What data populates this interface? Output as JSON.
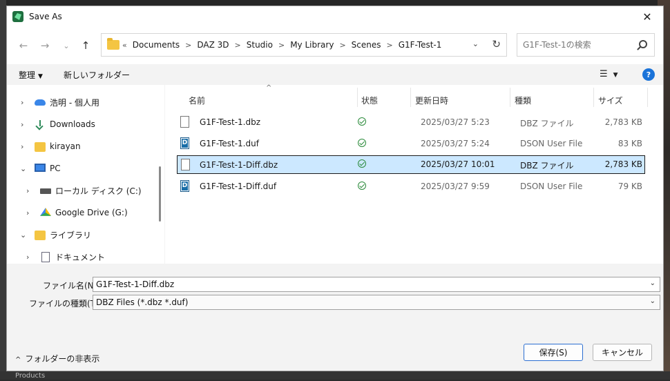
{
  "window": {
    "title": "Save As"
  },
  "address": {
    "lead": "«",
    "crumbs": [
      "Documents",
      "DAZ 3D",
      "Studio",
      "My Library",
      "Scenes",
      "G1F-Test-1"
    ]
  },
  "search": {
    "placeholder": "G1F-Test-1の検索"
  },
  "toolbar": {
    "organize_label": "整理",
    "new_folder_label": "新しいフォルダー",
    "help_label": "?"
  },
  "nav_pane": {
    "items": [
      {
        "label": "浩明 - 個人用",
        "icon": "cloud-icon"
      },
      {
        "label": "Downloads",
        "icon": "download-icon"
      },
      {
        "label": "kirayan",
        "icon": "folder-icon"
      },
      {
        "label": "PC",
        "icon": "monitor-icon"
      },
      {
        "label": "ローカル ディスク (C:)",
        "icon": "drive-icon"
      },
      {
        "label": "Google Drive (G:)",
        "icon": "google-drive-icon"
      },
      {
        "label": "ライブラリ",
        "icon": "folder-icon"
      },
      {
        "label": "ドキュメント",
        "icon": "document-icon"
      }
    ]
  },
  "file_list": {
    "columns": {
      "name": "名前",
      "status": "状態",
      "modified": "更新日時",
      "type": "種類",
      "size": "サイズ"
    },
    "rows": [
      {
        "name": "G1F-Test-1.dbz",
        "modified": "2025/03/27 5:23",
        "type": "DBZ ファイル",
        "size": "2,783 KB"
      },
      {
        "name": "G1F-Test-1.duf",
        "modified": "2025/03/27 5:24",
        "type": "DSON User File",
        "size": "83 KB"
      },
      {
        "name": "G1F-Test-1-Diff.dbz",
        "modified": "2025/03/27 10:01",
        "type": "DBZ ファイル",
        "size": "2,783 KB"
      },
      {
        "name": "G1F-Test-1-Diff.duf",
        "modified": "2025/03/27 9:59",
        "type": "DSON User File",
        "size": "79 KB"
      }
    ]
  },
  "form": {
    "filename_label": "ファイル名(N):",
    "filename_value": "G1F-Test-1-Diff.dbz",
    "filetype_label": "ファイルの種類(T):",
    "filetype_value": "DBZ Files (*.dbz *.duf)"
  },
  "footer": {
    "hide_folders_label": "フォルダーの非表示",
    "save_label": "保存(S)",
    "cancel_label": "キャンセル"
  },
  "background": {
    "products_label": "Products"
  },
  "colors": {
    "selection": "#cce8ff",
    "accent": "#1a73d9",
    "status_ok": "#2a8a3a"
  }
}
